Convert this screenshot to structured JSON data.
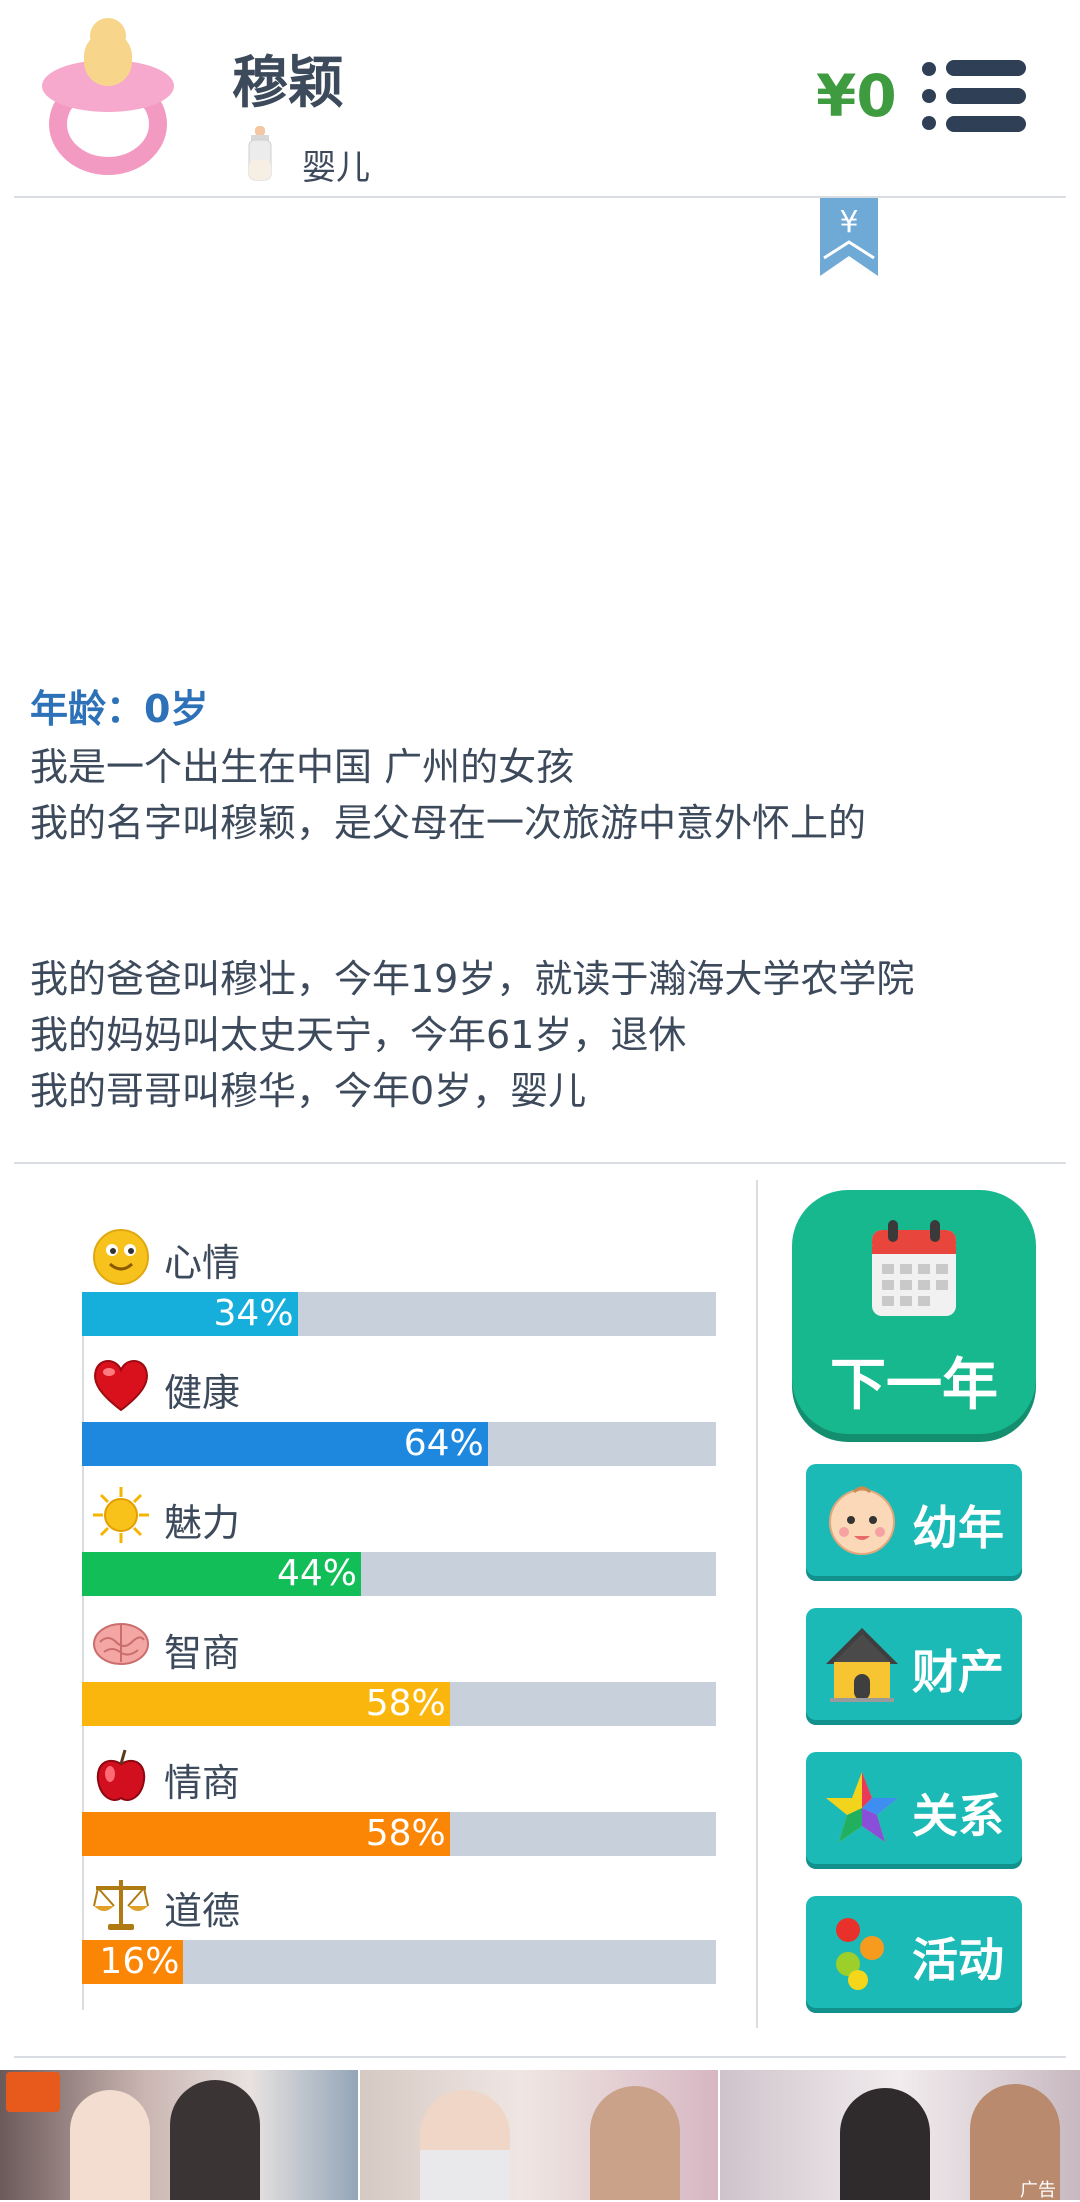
{
  "header": {
    "name": "穆颖",
    "stage": "婴儿",
    "money": "¥0",
    "ribbon_symbol": "¥"
  },
  "story": {
    "age": "年龄：0岁",
    "lines": [
      "我是一个出生在中国 广州的女孩",
      "我的名字叫穆颖，是父母在一次旅游中意外怀上的",
      "我的爸爸叫穆壮，今年19岁，就读于瀚海大学农学院",
      "我的妈妈叫太史天宁，今年61岁，退休",
      "我的哥哥叫穆华，今年0岁，婴儿"
    ]
  },
  "stats": [
    {
      "label": "心情",
      "value": 34,
      "text": "34%",
      "color": "#16aedb",
      "icon": "smiley-icon"
    },
    {
      "label": "健康",
      "value": 64,
      "text": "64%",
      "color": "#1e88df",
      "icon": "heart-icon"
    },
    {
      "label": "魅力",
      "value": 44,
      "text": "44%",
      "color": "#12be57",
      "icon": "sun-icon"
    },
    {
      "label": "智商",
      "value": 58,
      "text": "58%",
      "color": "#fbb60d",
      "icon": "brain-icon"
    },
    {
      "label": "情商",
      "value": 58,
      "text": "58%",
      "color": "#fb8505",
      "icon": "apple-icon"
    },
    {
      "label": "道德",
      "value": 16,
      "text": "16%",
      "color": "#fb8505",
      "icon": "scales-icon"
    }
  ],
  "buttons": {
    "next_year": "下一年",
    "stage_btn": "幼年",
    "property": "财产",
    "relations": "关系",
    "activity": "活动"
  },
  "ad": {
    "tag": "广告"
  }
}
